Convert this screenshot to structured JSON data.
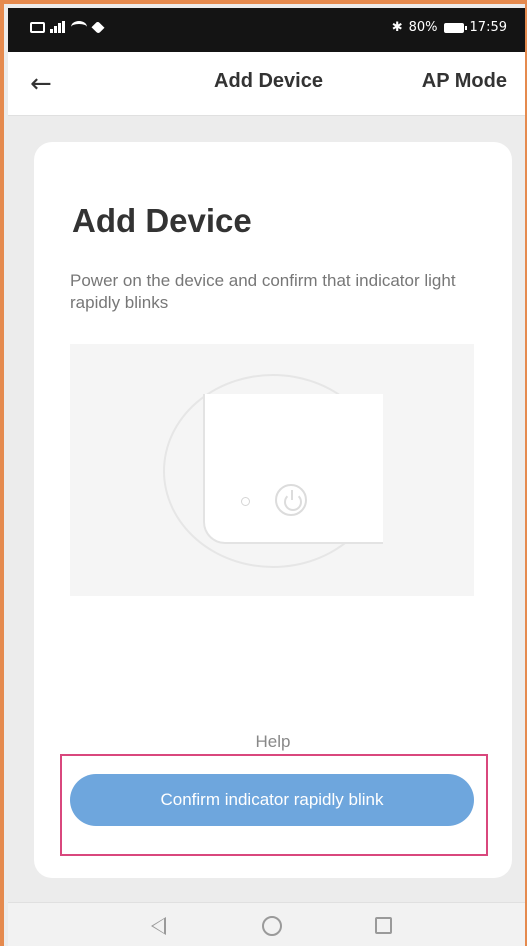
{
  "status_bar": {
    "battery": "80%",
    "time": "17:59"
  },
  "header": {
    "back_icon": "←",
    "title": "Add Device",
    "action": "AP Mode"
  },
  "card": {
    "title": "Add Device",
    "description": "Power on the device and confirm that indicator light rapidly blinks",
    "help_label": "Help",
    "confirm_label": "Confirm indicator rapidly blink"
  },
  "colors": {
    "confirm_button": "#6ea6dd",
    "highlight_border": "#d9477d",
    "frame_border": "#e58a4e"
  },
  "icons": {
    "back": "arrow-left-icon",
    "nav_back": "triangle-back-icon",
    "nav_home": "circle-home-icon",
    "nav_recent": "square-recent-icon",
    "illustration": "device-power-icon"
  }
}
